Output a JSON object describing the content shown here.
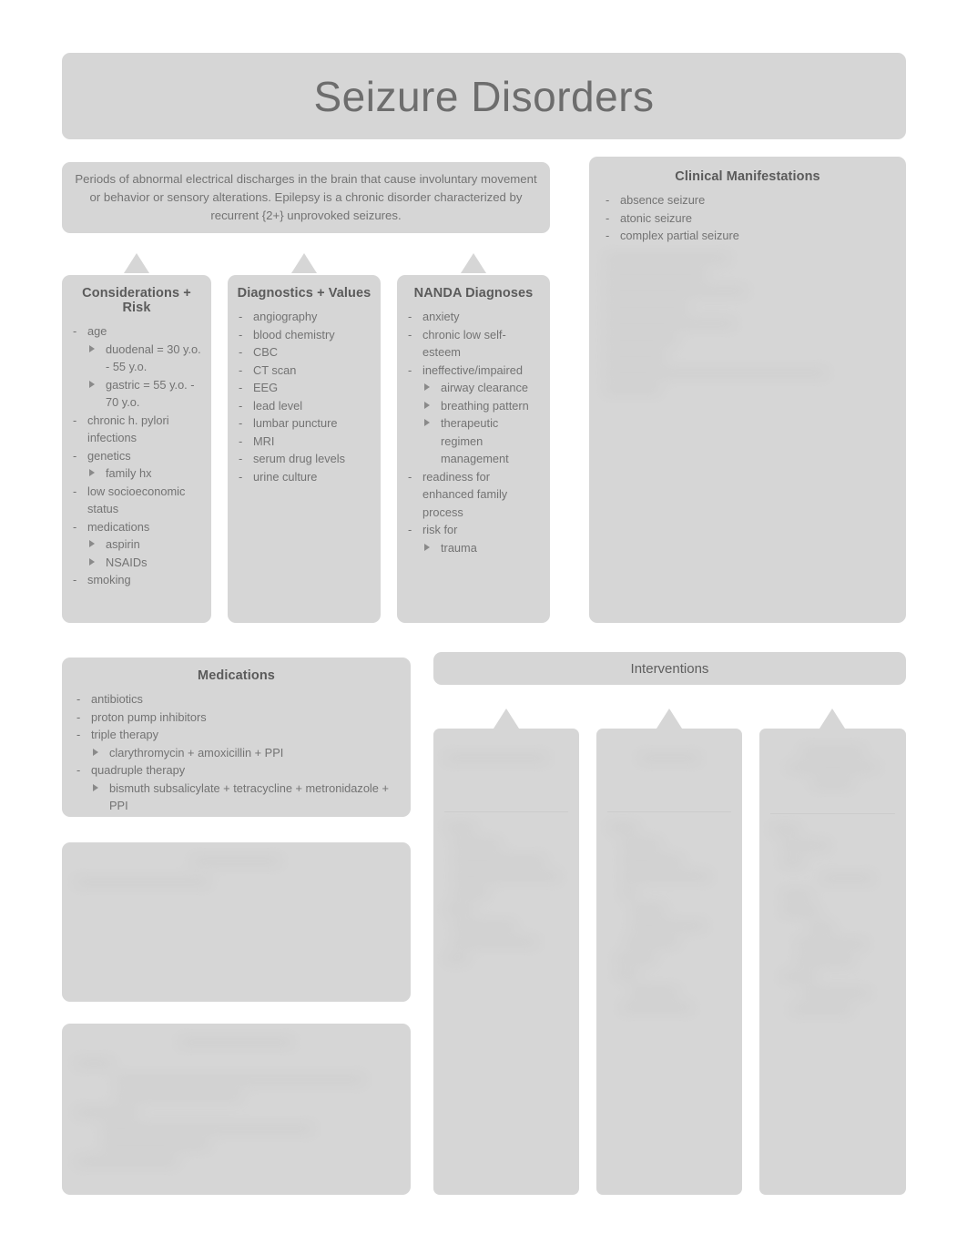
{
  "title": "Seizure Disorders",
  "description": "Periods of abnormal electrical discharges in the brain that cause involuntary movement or behavior or sensory alterations.  Epilepsy is a chronic disorder characterized by recurrent {2+} unprovoked seizures.",
  "clinical": {
    "heading": "Clinical Manifestations",
    "items": [
      "absence seizure",
      "atonic seizure",
      "complex partial seizure"
    ],
    "redacted_note": "(remaining items illegible / blurred)"
  },
  "considerations": {
    "heading": "Considerations + Risk",
    "items": [
      {
        "text": "age",
        "sub": [
          "duodenal = 30 y.o. - 55 y.o.",
          "gastric = 55 y.o. - 70 y.o."
        ]
      },
      {
        "text": "chronic h. pylori infections",
        "sub": []
      },
      {
        "text": "genetics",
        "sub": [
          "family hx"
        ]
      },
      {
        "text": "low socioeconomic status",
        "sub": []
      },
      {
        "text": "medications",
        "sub": [
          "aspirin",
          "NSAIDs"
        ]
      },
      {
        "text": "smoking",
        "sub": []
      }
    ]
  },
  "diagnostics": {
    "heading": "Diagnostics + Values",
    "items": [
      {
        "text": "angiography",
        "sub": []
      },
      {
        "text": "blood chemistry",
        "sub": []
      },
      {
        "text": "CBC",
        "sub": []
      },
      {
        "text": "CT scan",
        "sub": []
      },
      {
        "text": "EEG",
        "sub": []
      },
      {
        "text": "lead level",
        "sub": []
      },
      {
        "text": "lumbar puncture",
        "sub": []
      },
      {
        "text": "MRI",
        "sub": []
      },
      {
        "text": "serum drug levels",
        "sub": []
      },
      {
        "text": "urine culture",
        "sub": []
      }
    ]
  },
  "nanda": {
    "heading": "NANDA Diagnoses",
    "items": [
      {
        "text": "anxiety",
        "sub": []
      },
      {
        "text": "chronic low self-esteem",
        "sub": []
      },
      {
        "text": "ineffective/impaired",
        "sub": [
          "airway clearance",
          "breathing pattern",
          "therapeutic regimen management"
        ]
      },
      {
        "text": "readiness for enhanced family process",
        "sub": []
      },
      {
        "text": "risk for",
        "sub": [
          "trauma"
        ]
      }
    ]
  },
  "medications": {
    "heading": "Medications",
    "items": [
      {
        "text": "antibiotics",
        "sub": []
      },
      {
        "text": "proton pump inhibitors",
        "sub": []
      },
      {
        "text": "triple therapy",
        "sub": [
          "clarythromycin + amoxicillin + PPI"
        ]
      },
      {
        "text": "quadruple therapy",
        "sub": [
          "bismuth subsalicylate + tetracycline + metronidazole + PPI"
        ]
      }
    ]
  },
  "interventions": {
    "heading": "Interventions",
    "columns": [
      {
        "heading": "",
        "items": []
      },
      {
        "heading": "",
        "items": []
      },
      {
        "heading": "",
        "items": []
      }
    ]
  },
  "blurred_cards": [
    {
      "heading": "",
      "items": []
    },
    {
      "heading": "",
      "items": []
    }
  ],
  "colors": {
    "page_background": "#ffffff",
    "card_background": "#d6d6d6",
    "title_text": "#6d6d6d",
    "heading_text": "#5b5b5b",
    "body_text": "#737373"
  }
}
